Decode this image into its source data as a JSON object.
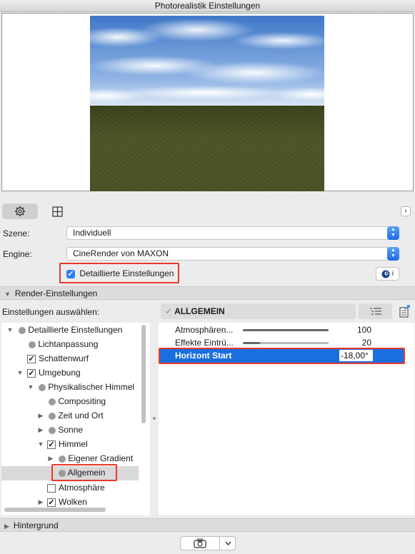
{
  "window": {
    "title": "Photorealistik Einstellungen"
  },
  "toolbar": {
    "settings_icon": "gear-icon",
    "layout_icon": "grid-icon",
    "expand_icon": "chevron-right-icon",
    "expand_glyph": "›"
  },
  "scene": {
    "label": "Szene:",
    "value": "Individuell"
  },
  "engine": {
    "label": "Engine:",
    "value": "CineRender von MAXON"
  },
  "detailed": {
    "label": "Detaillierte Einstellungen",
    "checked": true
  },
  "cinema_button": {
    "icon": "cinema4d-icon",
    "suffix": "i"
  },
  "render_section": {
    "label": "Render-Einstellungen",
    "expanded": true
  },
  "select_settings": {
    "label": "Einstellungen auswählen:",
    "group_name": "ALLGEMEIN"
  },
  "tree": [
    {
      "label": "Detaillierte Einstellungen",
      "type": "dot",
      "toggle": "open"
    },
    {
      "label": "Lichtanpassung",
      "type": "dot",
      "toggle": "none"
    },
    {
      "label": "Schattenwurf",
      "type": "checkbox",
      "checked": true,
      "toggle": "none"
    },
    {
      "label": "Umgebung",
      "type": "checkbox",
      "checked": true,
      "toggle": "open"
    },
    {
      "label": "Physikalischer Himmel",
      "type": "dot",
      "toggle": "open"
    },
    {
      "label": "Compositing",
      "type": "dot",
      "toggle": "none"
    },
    {
      "label": "Zeit und Ort",
      "type": "dot",
      "toggle": "closed"
    },
    {
      "label": "Sonne",
      "type": "dot",
      "toggle": "closed"
    },
    {
      "label": "Himmel",
      "type": "checkbox",
      "checked": true,
      "toggle": "open"
    },
    {
      "label": "Eigener Gradient",
      "type": "dot",
      "toggle": "closed"
    },
    {
      "label": "Allgemein",
      "type": "dot",
      "toggle": "none",
      "selected": true
    },
    {
      "label": "Atmosphäre",
      "type": "checkbox",
      "checked": false,
      "toggle": "none"
    },
    {
      "label": "Wolken",
      "type": "checkbox",
      "checked": true,
      "toggle": "closed"
    }
  ],
  "params": [
    {
      "label": "Atmosphären...",
      "value": "100",
      "slider_fraction": 1.0
    },
    {
      "label": "Effekte Eintrü...",
      "value": "20",
      "slider_fraction": 0.2
    },
    {
      "label": "Horizont Start",
      "value": "-18,00°",
      "selected": true
    }
  ],
  "background_section": {
    "label": "Hintergrund",
    "expanded": false
  },
  "footer": {
    "camera_icon": "camera-icon",
    "dropdown_icon": "chevron-down-icon"
  },
  "colors": {
    "accent": "#1b6ee0",
    "highlight_box": "#e8392a"
  }
}
